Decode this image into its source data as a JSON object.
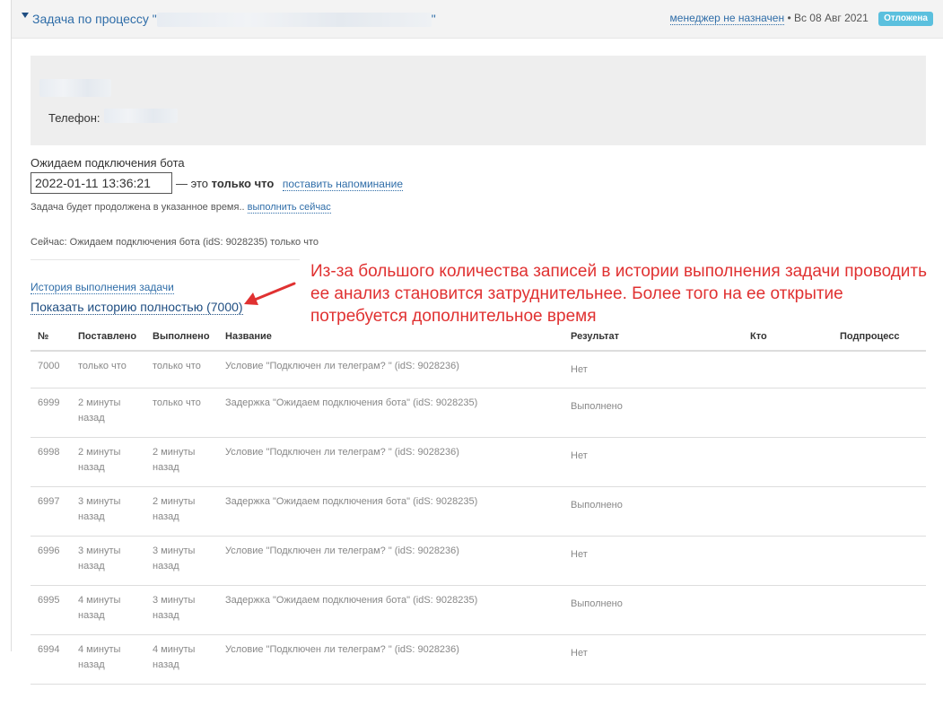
{
  "header": {
    "title_prefix": "Задача по процессу \"",
    "title_suffix": "\"",
    "manager": "менеджер не назначен",
    "date": "• Вс 08 Авг 2021",
    "status": "Отложена"
  },
  "contact": {
    "phone_label": "Телефон:"
  },
  "wait": {
    "label": "Ожидаем подключения бота",
    "datetime": "2022-01-11 13:36:21",
    "it_is_prefix": "— это",
    "it_is_bold": "только что",
    "reminder_link": "поставить напоминание",
    "hint": "Задача будет продолжена в указанное время..",
    "run_now_link": "выполнить сейчас"
  },
  "now_line": "Сейчас: Ожидаем подключения бота (idS: 9028235) только что",
  "history": {
    "link": "История выполнения задачи",
    "show_all": "Показать историю полностью (7000)"
  },
  "annotation": {
    "text": "Из-за большого количества записей в истории выполнения задачи проводить ее анализ становится затруднительнее. Более того на ее открытие потребуется дополнительное время",
    "color": "#e03131"
  },
  "table": {
    "headers": {
      "num": "№",
      "placed": "Поставлено",
      "done": "Выполнено",
      "name": "Название",
      "result": "Результат",
      "who": "Кто",
      "subprocess": "Подпроцесс"
    },
    "rows": [
      {
        "num": "7000",
        "placed": "только что",
        "done": "только что",
        "name": "Условие \"Подключен ли телеграм? \" (idS: 9028236)",
        "result": "Нет",
        "who": "",
        "subprocess": ""
      },
      {
        "num": "6999",
        "placed": "2 минуты назад",
        "done": "только что",
        "name": "Задержка \"Ожидаем подключения бота\" (idS: 9028235)",
        "result": "Выполнено",
        "who": "",
        "subprocess": ""
      },
      {
        "num": "6998",
        "placed": "2 минуты назад",
        "done": "2 минуты назад",
        "name": "Условие \"Подключен ли телеграм? \" (idS: 9028236)",
        "result": "Нет",
        "who": "",
        "subprocess": ""
      },
      {
        "num": "6997",
        "placed": "3 минуты назад",
        "done": "2 минуты назад",
        "name": "Задержка \"Ожидаем подключения бота\" (idS: 9028235)",
        "result": "Выполнено",
        "who": "",
        "subprocess": ""
      },
      {
        "num": "6996",
        "placed": "3 минуты назад",
        "done": "3 минуты назад",
        "name": "Условие \"Подключен ли телеграм? \" (idS: 9028236)",
        "result": "Нет",
        "who": "",
        "subprocess": ""
      },
      {
        "num": "6995",
        "placed": "4 минуты назад",
        "done": "3 минуты назад",
        "name": "Задержка \"Ожидаем подключения бота\" (idS: 9028235)",
        "result": "Выполнено",
        "who": "",
        "subprocess": ""
      },
      {
        "num": "6994",
        "placed": "4 минуты назад",
        "done": "4 минуты назад",
        "name": "Условие \"Подключен ли телеграм? \" (idS: 9028236)",
        "result": "Нет",
        "who": "",
        "subprocess": ""
      }
    ]
  },
  "icons": {
    "collapse": "caret-down-icon",
    "annotation_arrow": "arrow-icon"
  }
}
